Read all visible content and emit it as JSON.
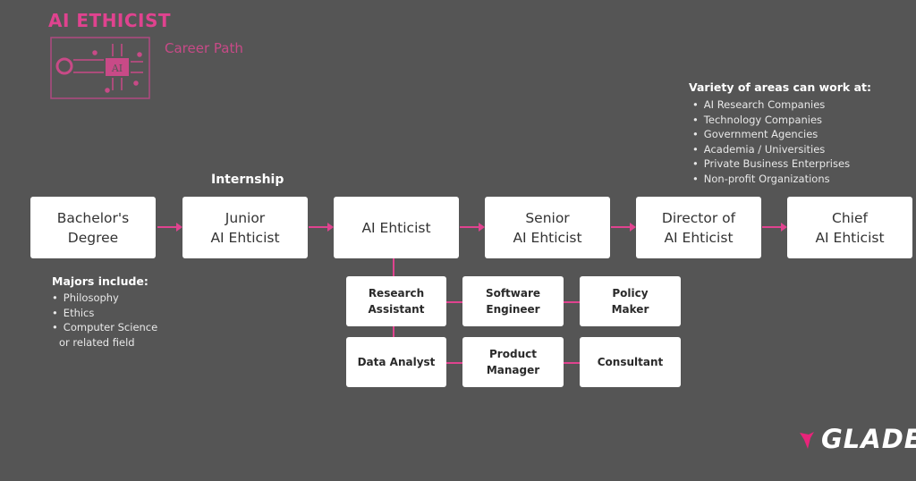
{
  "header": {
    "title": "AI ETHICIST",
    "subtitle": "Career Path",
    "icon": "ai-chip-circuit-icon"
  },
  "colors": {
    "background": "#555555",
    "accent": "#e0438f",
    "box": "#ffffff"
  },
  "internship_label": "Internship",
  "path": [
    {
      "line1": "Bachelor's",
      "line2": "Degree"
    },
    {
      "line1": "Junior",
      "line2": "AI Ehticist"
    },
    {
      "line1": "AI Ehticist",
      "line2": ""
    },
    {
      "line1": "Senior",
      "line2": "AI Ehticist"
    },
    {
      "line1": "Director of",
      "line2": "AI Ehticist"
    },
    {
      "line1": "Chief",
      "line2": "AI Ehticist"
    }
  ],
  "roles": [
    {
      "line1": "Research",
      "line2": "Assistant"
    },
    {
      "line1": "Software",
      "line2": "Engineer"
    },
    {
      "line1": "Policy",
      "line2": "Maker"
    },
    {
      "line1": "Data Analyst",
      "line2": ""
    },
    {
      "line1": "Product",
      "line2": "Manager"
    },
    {
      "line1": "Consultant",
      "line2": ""
    }
  ],
  "majors": {
    "title": "Majors include:",
    "items": [
      "Philosophy",
      "Ethics",
      "Computer Science"
    ],
    "continuation": "or related field"
  },
  "areas": {
    "title": "Variety of areas can work at:",
    "items": [
      "AI Research Companies",
      "Technology Companies",
      "Government Agencies",
      "Academia / Universities",
      "Private Business Enterprises",
      "Non-profit Organizations"
    ]
  },
  "logo": {
    "text": "GLADEO",
    "icon": "gladeo-figure-icon"
  }
}
